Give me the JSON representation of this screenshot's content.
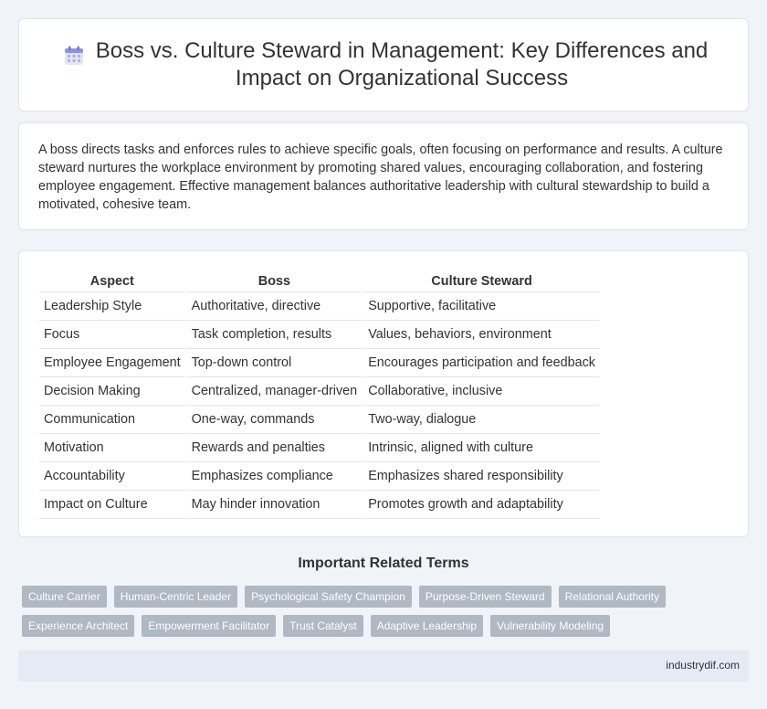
{
  "header": {
    "icon": "calendar-icon",
    "title": "Boss vs. Culture Steward in Management: Key Differences and Impact on Organizational Success"
  },
  "intro": {
    "text": "A boss directs tasks and enforces rules to achieve specific goals, often focusing on performance and results. A culture steward nurtures the workplace environment by promoting shared values, encouraging collaboration, and fostering employee engagement. Effective management balances authoritative leadership with cultural stewardship to build a motivated, cohesive team."
  },
  "table": {
    "headers": [
      "Aspect",
      "Boss",
      "Culture Steward"
    ],
    "rows": [
      [
        "Leadership Style",
        "Authoritative, directive",
        "Supportive, facilitative"
      ],
      [
        "Focus",
        "Task completion, results",
        "Values, behaviors, environment"
      ],
      [
        "Employee Engagement",
        "Top-down control",
        "Encourages participation and feedback"
      ],
      [
        "Decision Making",
        "Centralized, manager-driven",
        "Collaborative, inclusive"
      ],
      [
        "Communication",
        "One-way, commands",
        "Two-way, dialogue"
      ],
      [
        "Motivation",
        "Rewards and penalties",
        "Intrinsic, aligned with culture"
      ],
      [
        "Accountability",
        "Emphasizes compliance",
        "Emphasizes shared responsibility"
      ],
      [
        "Impact on Culture",
        "May hinder innovation",
        "Promotes growth and adaptability"
      ]
    ]
  },
  "related": {
    "heading": "Important Related Terms",
    "tags": [
      "Culture Carrier",
      "Human-Centric Leader",
      "Psychological Safety Champion",
      "Purpose-Driven Steward",
      "Relational Authority",
      "Experience Architect",
      "Empowerment Facilitator",
      "Trust Catalyst",
      "Adaptive Leadership",
      "Vulnerability Modeling"
    ]
  },
  "footer": {
    "site": "industrydif.com"
  },
  "colors": {
    "background": "#f0f3f8",
    "tag": "#b0b8c4",
    "footer": "#e4ebf5",
    "icon_accent": "#8b93e8"
  }
}
